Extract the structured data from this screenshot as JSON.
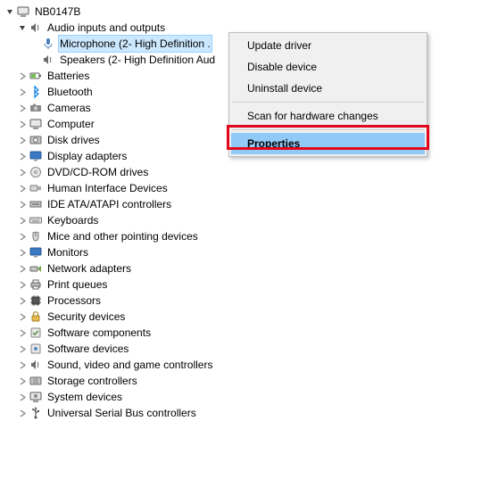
{
  "root": {
    "label": "NB0147B"
  },
  "audio": {
    "label": "Audio inputs and outputs",
    "mic": "Microphone (2- High Definition .",
    "speakers": "Speakers (2- High Definition Aud"
  },
  "categories": [
    {
      "key": "batteries",
      "label": "Batteries"
    },
    {
      "key": "bluetooth",
      "label": "Bluetooth"
    },
    {
      "key": "cameras",
      "label": "Cameras"
    },
    {
      "key": "computer",
      "label": "Computer"
    },
    {
      "key": "diskdrives",
      "label": "Disk drives"
    },
    {
      "key": "displayadapters",
      "label": "Display adapters"
    },
    {
      "key": "dvdcdrom",
      "label": "DVD/CD-ROM drives"
    },
    {
      "key": "hid",
      "label": "Human Interface Devices"
    },
    {
      "key": "ide",
      "label": "IDE ATA/ATAPI controllers"
    },
    {
      "key": "keyboards",
      "label": "Keyboards"
    },
    {
      "key": "mice",
      "label": "Mice and other pointing devices"
    },
    {
      "key": "monitors",
      "label": "Monitors"
    },
    {
      "key": "netadapters",
      "label": "Network adapters"
    },
    {
      "key": "printqueues",
      "label": "Print queues"
    },
    {
      "key": "processors",
      "label": "Processors"
    },
    {
      "key": "security",
      "label": "Security devices"
    },
    {
      "key": "softcomp",
      "label": "Software components"
    },
    {
      "key": "softdev",
      "label": "Software devices"
    },
    {
      "key": "sound",
      "label": "Sound, video and game controllers"
    },
    {
      "key": "storage",
      "label": "Storage controllers"
    },
    {
      "key": "sysdev",
      "label": "System devices"
    },
    {
      "key": "usb",
      "label": "Universal Serial Bus controllers"
    }
  ],
  "contextMenu": {
    "updateDriver": "Update driver",
    "disableDevice": "Disable device",
    "uninstallDevice": "Uninstall device",
    "scanHardware": "Scan for hardware changes",
    "properties": "Properties"
  }
}
